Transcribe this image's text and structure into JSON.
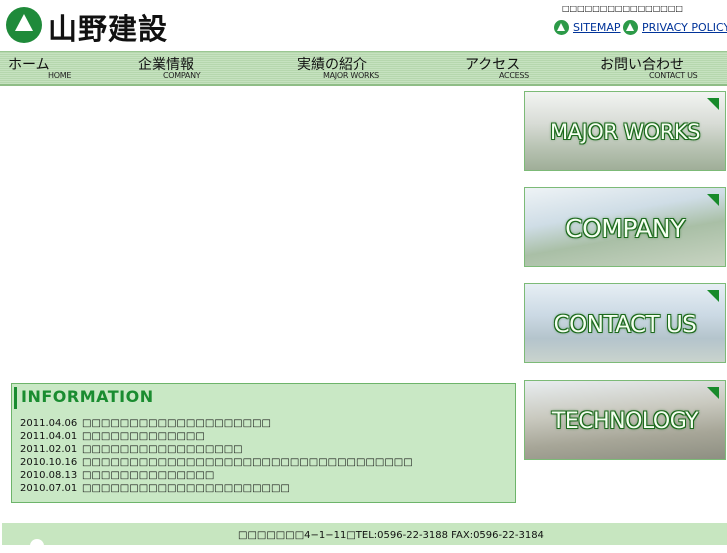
{
  "header": {
    "logo_text": "山野建設",
    "tagline": "□□□□□□□□□□□□□□□□",
    "links": [
      {
        "label": "SITEMAP"
      },
      {
        "label": "PRIVACY POLICY"
      }
    ]
  },
  "nav": [
    {
      "jp": "ホーム",
      "en": "HOME"
    },
    {
      "jp": "企業情報",
      "en": "COMPANY"
    },
    {
      "jp": "実績の紹介",
      "en": "MAJOR WORKS"
    },
    {
      "jp": "アクセス",
      "en": "ACCESS"
    },
    {
      "jp": "お問い合わせ",
      "en": "CONTACT US"
    }
  ],
  "info": {
    "title": "INFORMATION",
    "news": [
      {
        "date": "2011.04.06",
        "text": "□□□□□□□□□□□□□□□□□□□□"
      },
      {
        "date": "2011.04.01",
        "text": "□□□□□□□□□□□□□"
      },
      {
        "date": "2011.02.01",
        "text": "□□□□□□□□□□□□□□□□□"
      },
      {
        "date": "2010.10.16",
        "text": "□□□□□□□□□□□□□□□□□□□□□□□□□□□□□□□□□□□"
      },
      {
        "date": "2010.08.13",
        "text": "□□□□□□□□□□□□□□"
      },
      {
        "date": "2010.07.01",
        "text": "□□□□□□□□□□□□□□□□□□□□□□"
      }
    ]
  },
  "banners": [
    {
      "label": "MAJOR WORKS"
    },
    {
      "label": "COMPANY"
    },
    {
      "label": "CONTACT US"
    },
    {
      "label": "TECHNOLOGY"
    }
  ],
  "footer": {
    "address": "□□□□□□□4−1−11□TEL:0596-22-3188 FAX:0596-22-3184"
  },
  "colors": {
    "brand_green": "#1a8c30",
    "nav_bg": "#bfdcb8",
    "info_bg": "#c9e8c5",
    "link_blue": "#003399"
  }
}
